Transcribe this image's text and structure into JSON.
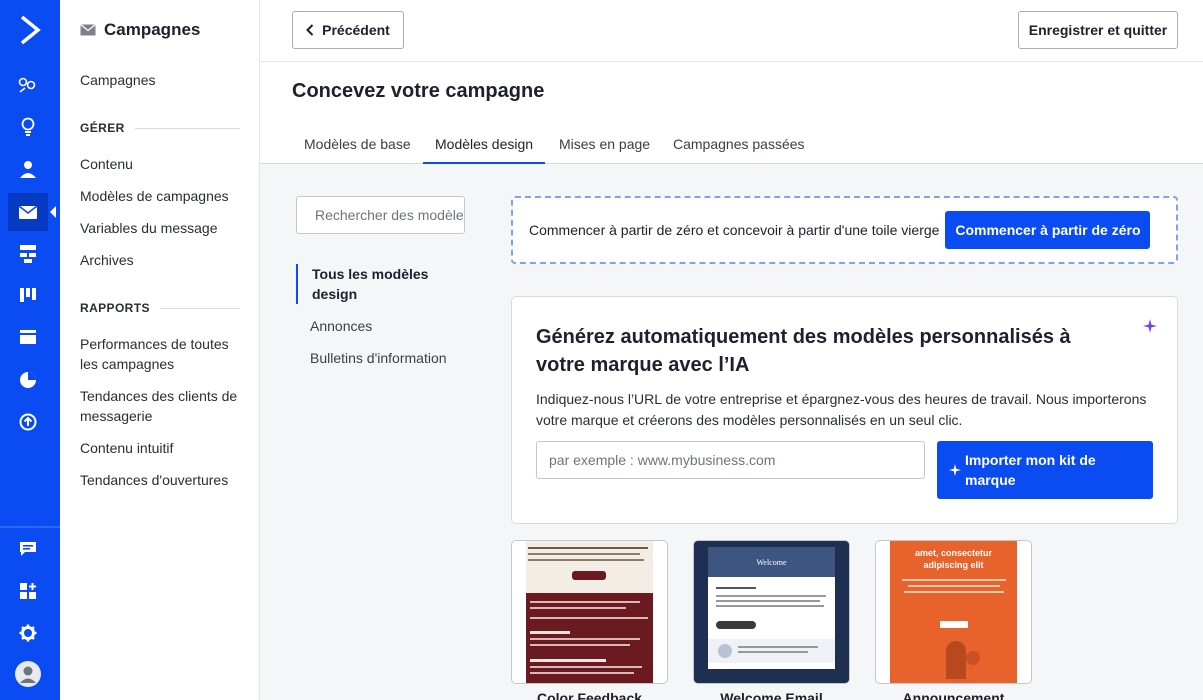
{
  "app": {
    "rail_items": [
      "logo-icon",
      "contacts-icon",
      "ideas-icon",
      "user-icon",
      "mail-icon",
      "automation-icon",
      "board-icon",
      "pages-icon",
      "reports-icon",
      "upload-icon",
      "chat-icon",
      "apps-icon",
      "settings-icon",
      "account-icon"
    ]
  },
  "sidebar": {
    "title": "Campagnes",
    "top_link": "Campagnes",
    "section1_title": "GÉRER",
    "section1_items": [
      "Contenu",
      "Modèles de campagnes",
      "Variables du message",
      "Archives"
    ],
    "section2_title": "RAPPORTS",
    "section2_items": [
      "Performances de toutes les campagnes",
      "Tendances des clients de messagerie",
      "Contenu intuitif",
      "Tendances d'ouvertures"
    ]
  },
  "topbar": {
    "back_label": "Précédent",
    "save_label": "Enregistrer et quitter"
  },
  "page": {
    "title": "Concevez votre campagne",
    "tabs": [
      "Modèles de base",
      "Modèles design",
      "Mises en page",
      "Campagnes passées"
    ],
    "active_tab": "Modèles design"
  },
  "filters": {
    "search_placeholder": "Rechercher des modèles",
    "items": [
      "Tous les modèles design",
      "Annonces",
      "Bulletins d'information"
    ],
    "active": "Tous les modèles design"
  },
  "scratch": {
    "text": "Commencer à partir de zéro et concevoir à partir d'une toile vierge",
    "button": "Commencer à partir de zéro"
  },
  "ai": {
    "title": "Générez automatiquement des modèles personnalisés à votre marque avec l’IA",
    "description": "Indiquez-nous l’URL de votre entreprise et épargnez-vous des heures de travail. Nous importerons votre marque et créerons des modèles personnalisés en un seul clic.",
    "input_placeholder": "par exemple : www.mybusiness.com",
    "button": "Importer mon kit de marque"
  },
  "templates": [
    {
      "label": "Color Feedback"
    },
    {
      "label": "Welcome Email",
      "preview_heading": "Welcome"
    },
    {
      "label": "Announcement",
      "preview_heading": "amet, consectetur adipiscing elit"
    }
  ],
  "colors": {
    "brand": "#0a4cf2",
    "rail_active": "#073ac2",
    "content_bg": "#f5f6f8"
  }
}
